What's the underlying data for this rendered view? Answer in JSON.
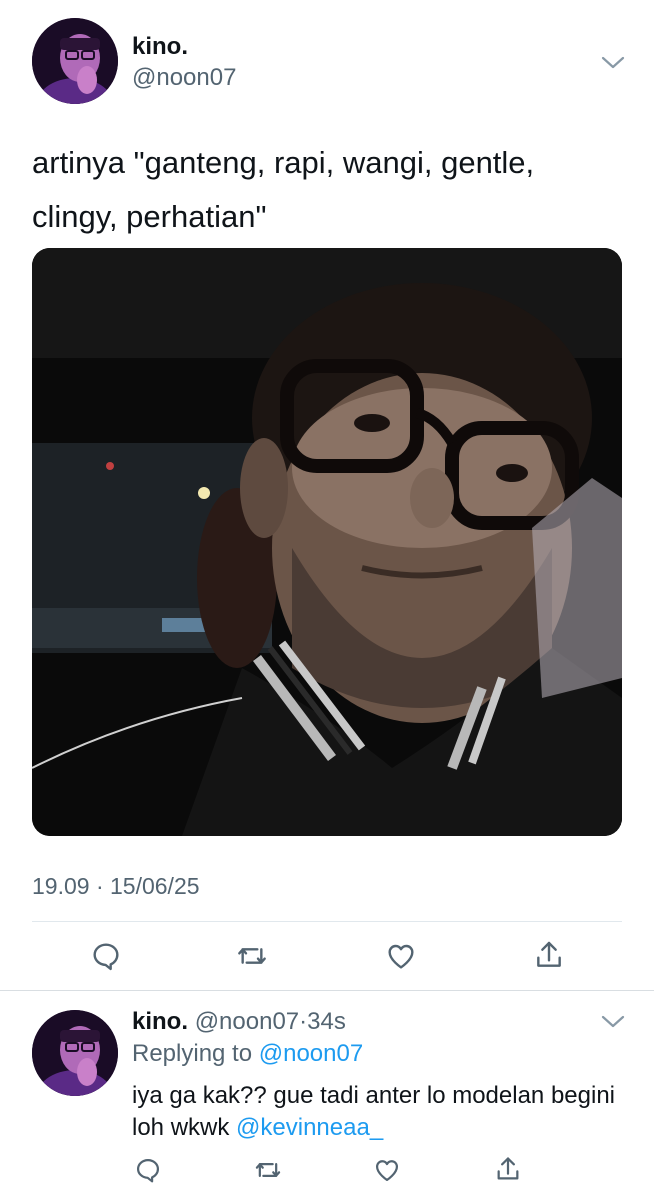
{
  "colors": {
    "text": "#0f1419",
    "secondary": "#536471",
    "link": "#1d9bf0",
    "divider": "#e1e8ed"
  },
  "tweet": {
    "display_name": "kino.",
    "handle": "@noon07",
    "text": "artinya \"ganteng, rapi, wangi, gentle, clingy, perhatian\"",
    "timestamp": "19.09 · 15/06/25",
    "icons": [
      "more-chevron-icon",
      "reply-icon",
      "retweet-icon",
      "like-icon",
      "share-icon"
    ]
  },
  "reply": {
    "display_name": "kino.",
    "handle": "@noon07",
    "dot": "·",
    "time": "34s",
    "replying_prefix": "Replying to",
    "replying_to": "@noon07",
    "text": "iya ga kak?? gue tadi anter lo modelan begini loh wkwk",
    "mention": "@kevinneaa_"
  }
}
